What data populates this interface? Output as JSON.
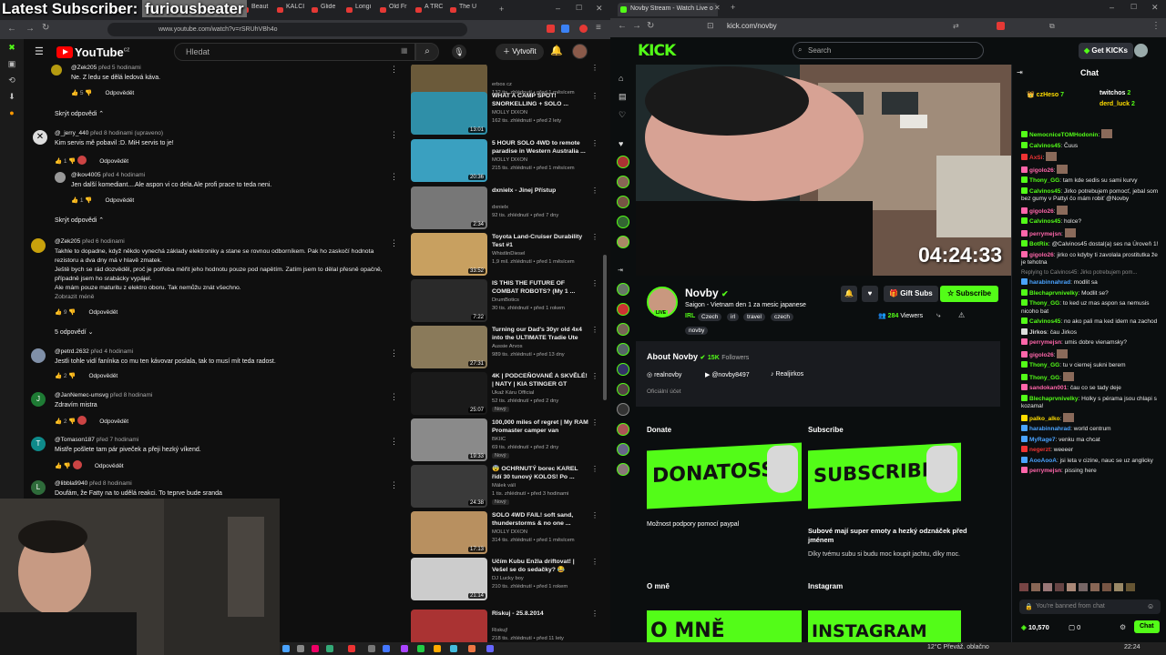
{
  "overlay": {
    "title_prefix": "Latest Subscriber: ",
    "title_name": "furiousbeater"
  },
  "left_browser": {
    "tabs": [
      "Beaut",
      "KALCI",
      "Glide",
      "Longi",
      "Old Fr",
      "A TRC",
      "The U"
    ],
    "url": "www.youtube.com/watch?v=rSRUhVBh4o",
    "youtube": {
      "logo": "YouTube",
      "logo_region": "CZ",
      "search_placeholder": "Hledat",
      "create_label": "Vytvořit",
      "comments": [
        {
          "author": "@Zek205",
          "time": "před 5 hodinami",
          "text": "Ne. Z ledu se dělá ledová káva.",
          "likes": "5",
          "reply": "Odpovědět"
        },
        {
          "toggle": "Skrýt odpovědi"
        },
        {
          "author": "@_jerry_440",
          "time": "před 8 hodinami (upraveno)",
          "text": "Kim servis mě pobavil :D.  MiH servis to je!",
          "likes": "1",
          "reply": "Odpovědět"
        },
        {
          "author": "@ikov4005",
          "time": "před 4 hodinami",
          "text": "Jen další komediant....Ale aspon vi co dela.Ale profi prace to teda neni.",
          "likes": "1",
          "reply": "Odpovědět"
        },
        {
          "toggle": "Skrýt odpovědi"
        },
        {
          "author": "@Zek205",
          "time": "před 6 hodinami",
          "text_lines": [
            "Takhle to dopadne, když někdo vynechá základy elektroniky a stane se rovnou odborníkem. Pak ho zaskočí hodnota",
            "rezistoru a dva dny má v hlavě zmatek.",
            "Ještě bych se rád dozvěděl, proč je potřeba měřit jeho hodnotu pouze pod napětím. Zatím jsem to dělal přesně opačně,",
            "případně jsem ho srabácky vypájel.",
            "Ale mám pouze maturitu z elektro oboru. Tak nemůžu znát všechno."
          ],
          "more": "Zobrazit méně",
          "likes": "9",
          "reply": "Odpovědět"
        },
        {
          "toggle": "5 odpovědí"
        },
        {
          "author": "@petrd.2632",
          "time": "před 4 hodinami",
          "text": "Jestli tohle vidí fanínka co mu ten kávovar poslala, tak to musí mít teda radost.",
          "likes": "2",
          "reply": "Odpovědět"
        },
        {
          "author": "@JanNemec-umsvg",
          "time": "před 8 hodinami",
          "text": "Zdravím mistra",
          "likes": "2",
          "reply": "Odpovědět"
        },
        {
          "author": "@Tomason187",
          "time": "před 7 hodinami",
          "text": "Mistře pošlete tam pár piveček a přeji hezký víkend.",
          "likes": "",
          "reply": "Odpovědět"
        },
        {
          "author": "@libbla9940",
          "time": "před 8 hodinami",
          "text": "Doufám, že Fatty na to udělá reakci. To teprve bude sranda"
        }
      ],
      "recommended": [
        {
          "title": "",
          "channel": "erbos cz",
          "views": "132 tis. zhlédnutí • před 1 měsícem",
          "duration": "34:29"
        },
        {
          "title": "WHAT A CAMP SPOT! SNORKELLING + SOLO ...",
          "channel": "MOLLY DIXON",
          "views": "162 tis. zhlédnutí • před 2 lety",
          "duration": "13:01"
        },
        {
          "title": "5 HOUR SOLO 4WD to remote paradise in Western Australia ...",
          "channel": "MOLLY DIXON",
          "views": "215 tis. zhlédnutí • před 1 měsícem",
          "duration": "20:36"
        },
        {
          "title": "dxnielx - Jinej Přístup",
          "channel": "dxnielx",
          "views": "92 tis. zhlédnutí • před 7 dny",
          "duration": "2:34"
        },
        {
          "title": "Toyota Land-Cruiser Durability Test #1",
          "channel": "WhistlinDiesel",
          "views": "1,9 mil. zhlédnutí • před 1 měsícem",
          "duration": "33:52"
        },
        {
          "title": "IS THIS THE FUTURE OF COMBAT ROBOTS? (My 1 ...",
          "channel": "DrumBotics",
          "views": "30 tis. zhlédnutí • před 1 rokem",
          "duration": "7:22"
        },
        {
          "title": "Turning our Dad's 30yr old 4x4 into the ULTIMATE Tradie Ute",
          "channel": "Aussie Arvos",
          "views": "989 tis. zhlédnutí • před 13 dny",
          "duration": "27:31"
        },
        {
          "title": "4K | PODCEŇOVANÉ A SKVĚLÉ! | NATY | KIA STINGER GT",
          "channel": "Ukaž Káru Official",
          "views": "52 tis. zhlédnutí • před 2 dny",
          "duration": "25:07",
          "badge": "Nový"
        },
        {
          "title": "100,000 miles of regret | My RAM Promaster camper van",
          "channel": "BKIIC",
          "views": "69 tis. zhlédnutí • před 2 dny",
          "duration": "19:33",
          "badge": "Nový"
        },
        {
          "title": "😨 OCHRNUTÝ borec KAREL řídí 30 tunový KOLOS! Po ...",
          "channel": "Málek válí",
          "views": "1 tis. zhlédnutí • před 3 hodinami",
          "duration": "24:38",
          "badge": "Nový"
        },
        {
          "title": "SOLO 4WD FAIL! soft sand, thunderstorms & no one ...",
          "channel": "MOLLY DIXON",
          "views": "314 tis. zhlédnutí • před 1 měsícem",
          "duration": "17:13"
        },
        {
          "title": "Učím Kubu Enžla driftovat! | Vešel se do sedačky? 😂",
          "channel": "DJ Lucky boy",
          "views": "210 tis. zhlédnutí • před 1 rokem",
          "duration": "21:14"
        },
        {
          "title": "Riskuj - 25.8.2014",
          "channel": "Riskuj!",
          "views": "218 tis. zhlédnutí • před 11 lety",
          "duration": ""
        }
      ]
    }
  },
  "right_browser": {
    "tab_title": "Novby Stream - Watch Live o",
    "url": "kick.com/novby",
    "kick": {
      "logo": "KICK",
      "search_placeholder": "Search",
      "get_kicks": "Get KICKs",
      "timer": "04:24:33",
      "live_badge": "LIVE",
      "streamer": "Novby",
      "stream_title": "Saigon - Vietnam den 1 za mesic japanese",
      "tags": [
        "IRL",
        "Czech",
        "irl",
        "travel",
        "czech",
        "novby"
      ],
      "gift_subs": "Gift Subs",
      "subscribe": "Subscribe",
      "viewers": "284",
      "viewers_label": "Viewers",
      "about_title": "About Novby",
      "followers": "15K",
      "followers_label": "Followers",
      "socials": [
        "realnovby",
        "@novby8497",
        "Realjirkos"
      ],
      "official": "Oficiální účet",
      "panels": [
        {
          "heading": "Donate",
          "image_text": "DONATOSS",
          "desc": "Možnost podpory pomocí paypal"
        },
        {
          "heading": "Subscribe",
          "image_text": "SUBSCRIBE",
          "desc_bold": "Subové mají super emoty a hezký odznáček před jménem",
          "desc": "Díky tvému subu si budu moc koupit jachtu, díky moc."
        },
        {
          "heading": "O mně",
          "image_text": "O MNĚ"
        },
        {
          "heading": "Instagram",
          "image_text": "INSTAGRAM"
        }
      ]
    },
    "chat": {
      "title": "Chat",
      "top_gifters": [
        {
          "name": "czHeso",
          "count": "7"
        },
        {
          "name": "twitchos",
          "count": "2"
        },
        {
          "name": "derd_luck",
          "count": "2"
        }
      ],
      "messages": [
        {
          "user": "NemocniceTOMHodonin",
          "text": "",
          "color": "#53fc18"
        },
        {
          "user": "Calvinos45",
          "text": "Čuus",
          "color": "#53fc18"
        },
        {
          "user": "AxSi",
          "text": "",
          "color": "#e33"
        },
        {
          "user": "gigolo26",
          "text": "",
          "color": "#f6a"
        },
        {
          "user": "Thony_GG",
          "text": "tam kde sedis su sami kurvy",
          "color": "#53fc18"
        },
        {
          "user": "Calvinos45",
          "text": "Jirko potrebujem pomocť, jebal som bez gumy v Pattyi čo mám robiť @Novby",
          "color": "#53fc18"
        },
        {
          "user": "gigolo26",
          "text": "",
          "color": "#f6a"
        },
        {
          "user": "Calvinos45",
          "text": "holce?",
          "color": "#53fc18"
        },
        {
          "user": "perrymejsn",
          "text": "",
          "color": "#f6a"
        },
        {
          "user": "BotRix",
          "text": "@Calvinos45 dostal(a) ses na Úroveň 1!",
          "color": "#53fc18"
        },
        {
          "user": "gigolo26",
          "text": "jirko co kdyby ti zavolala prostitutka že je tehotna",
          "color": "#f6a"
        },
        {
          "user": "",
          "text": "Replying to Calvinos45: Jirko potrebujem pom...",
          "color": "#888",
          "reply": true
        },
        {
          "user": "harabinnahrad",
          "text": "modlit sa",
          "color": "#4aa3ff"
        },
        {
          "user": "Blechaprvnivelky",
          "text": "Modlit se?",
          "color": "#53fc18"
        },
        {
          "user": "Thony_GG",
          "text": "to ked uz mas aspon sa nemusis nicoho bat",
          "color": "#53fc18"
        },
        {
          "user": "Calvinos45",
          "text": "no ako pali ma ked idem na zachod",
          "color": "#53fc18"
        },
        {
          "user": "Jirkos",
          "text": "čau Jirkos",
          "color": "#ddd"
        },
        {
          "user": "perrymejsn",
          "text": "umis dobre vienamsky?",
          "color": "#f6a"
        },
        {
          "user": "gigolo26",
          "text": "",
          "color": "#f6a"
        },
        {
          "user": "Thony_GG",
          "text": "tu v ciernej sukni berem",
          "color": "#53fc18"
        },
        {
          "user": "Thony_GG",
          "text": "",
          "color": "#53fc18"
        },
        {
          "user": "sandokan001",
          "text": "čau co se tady deje",
          "color": "#f6a"
        },
        {
          "user": "Blechaprvnivelky",
          "text": "Holky s pérama jsou chlapi s kozama!",
          "color": "#53fc18"
        },
        {
          "user": "palko_alko",
          "text": "",
          "color": "#fd0"
        },
        {
          "user": "harabinnahrad",
          "text": "world centrum",
          "color": "#4aa3ff"
        },
        {
          "user": "MyRage7",
          "text": "venku ma chcat",
          "color": "#4aa3ff"
        },
        {
          "user": "negerzt",
          "text": "weeeer",
          "color": "#e33"
        },
        {
          "user": "AooAooA",
          "text": "jsi leta v cizine, nauc se uz anglicky",
          "color": "#4aa3ff"
        },
        {
          "user": "perrymejsn",
          "text": "pissing here",
          "color": "#f6a"
        }
      ],
      "banned_placeholder": "You're banned from chat",
      "points": "10,570",
      "zero": "0",
      "chat_button": "Chat"
    }
  },
  "taskbar": {
    "weather": "12°C  Převáž. oblačno",
    "time": "22:24"
  }
}
